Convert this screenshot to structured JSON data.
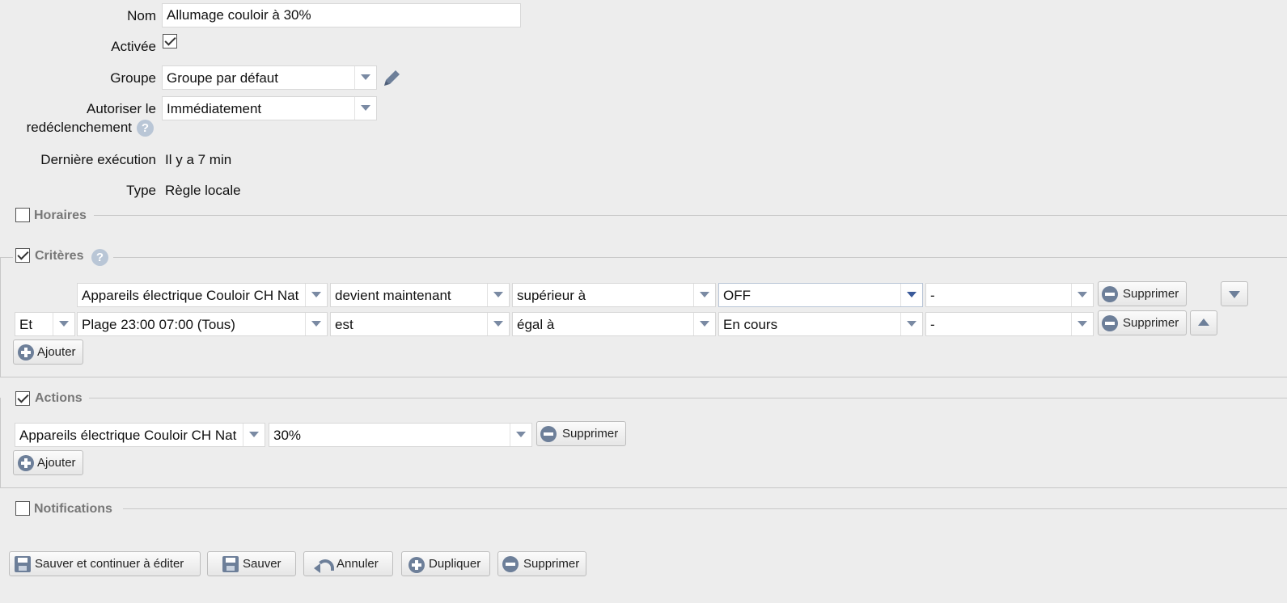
{
  "form": {
    "nom_label": "Nom",
    "nom_value": "Allumage couloir à 30%",
    "activee_label": "Activée",
    "groupe_label": "Groupe",
    "groupe_value": "Groupe par défaut",
    "autoriser_label_1": "Autoriser le",
    "autoriser_label_2": "redéclenchement",
    "autoriser_value": "Immédiatement",
    "derniere_label": "Dernière exécution",
    "derniere_value": "Il y a 7 min",
    "type_label": "Type",
    "type_value": "Règle locale"
  },
  "sections": {
    "horaires": "Horaires",
    "criteres": "Critères",
    "actions": "Actions",
    "notifications": "Notifications"
  },
  "criteres": [
    {
      "device": "Appareils électrique Couloir CH Nat",
      "verb": "devient maintenant",
      "comparator": "supérieur à",
      "value": "OFF",
      "extra": "-",
      "delete": "Supprimer"
    },
    {
      "conj": "Et",
      "device": "Plage 23:00 07:00 (Tous)",
      "verb": "est",
      "comparator": "égal à",
      "value": "En cours",
      "extra": "-",
      "delete": "Supprimer"
    }
  ],
  "actions": [
    {
      "device": "Appareils électrique Couloir CH Nat",
      "value": "30%",
      "delete": "Supprimer"
    }
  ],
  "add_label": "Ajouter",
  "help_glyph": "?",
  "footer": {
    "save_continue": "Sauver et continuer à éditer",
    "save": "Sauver",
    "cancel": "Annuler",
    "duplicate": "Dupliquer",
    "delete": "Supprimer"
  },
  "icons": [
    "pencil-icon",
    "help-icon",
    "minus-circle-icon",
    "plus-circle-icon",
    "save-icon",
    "undo-icon",
    "chevron-down-icon",
    "arrow-up-icon",
    "arrow-down-icon"
  ],
  "colors": {
    "background": "#ededed",
    "icon": "#6d7f99",
    "section_title": "#777777"
  }
}
